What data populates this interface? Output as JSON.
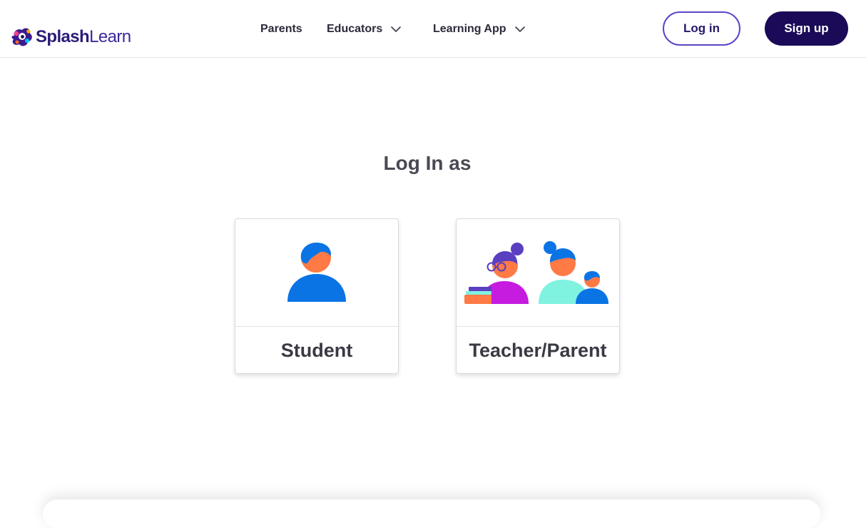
{
  "header": {
    "logo": {
      "brand_bold": "Splash",
      "brand_thin": "Learn",
      "icon": "splashlearn-logo-icon"
    },
    "nav": [
      {
        "label": "Parents",
        "has_dropdown": false
      },
      {
        "label": "Educators",
        "has_dropdown": true
      },
      {
        "label": "Learning App",
        "has_dropdown": true
      }
    ],
    "login_label": "Log in",
    "signup_label": "Sign up"
  },
  "main": {
    "title": "Log In as",
    "cards": [
      {
        "label": "Student",
        "icon": "student-avatar-icon"
      },
      {
        "label": "Teacher/Parent",
        "icon": "teacher-parent-avatar-icon"
      }
    ]
  },
  "colors": {
    "brand_dark": "#1b0a57",
    "login_border": "#5b46c9",
    "student_blue": "#0b74e5",
    "skin_orange": "#ff7a45",
    "teacher_magenta": "#c51ce0",
    "parent_mint": "#7ff2e0",
    "hair_purple": "#5a3fc0"
  }
}
